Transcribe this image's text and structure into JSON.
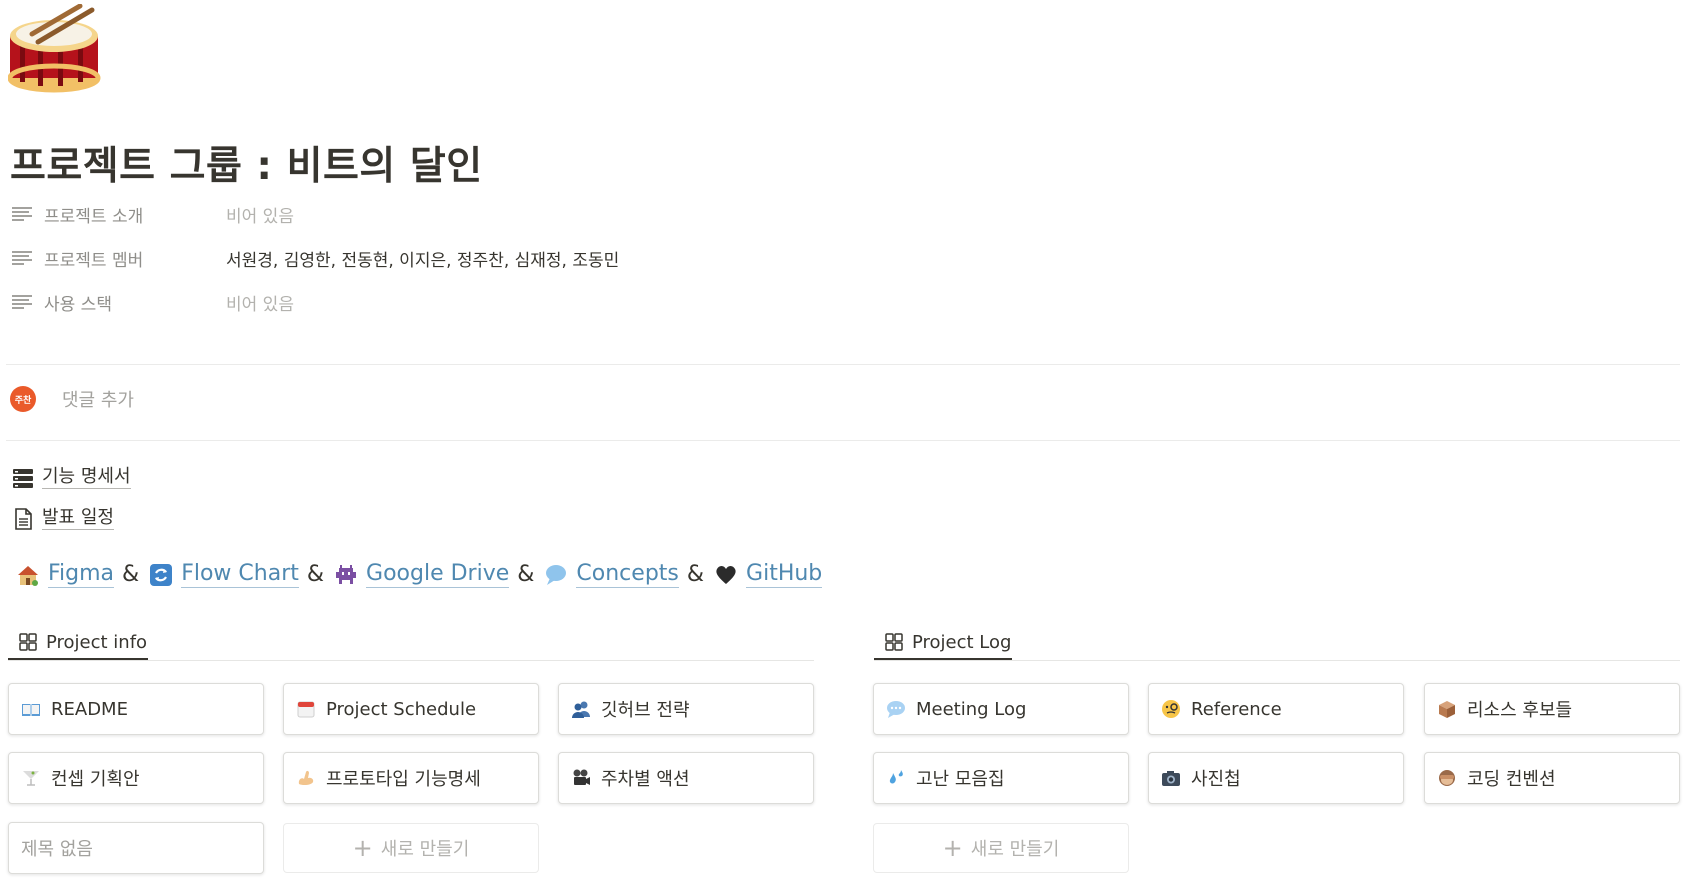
{
  "page": {
    "icon": "drum-icon",
    "title": "프로젝트 그룹 : 비트의 달인"
  },
  "properties": [
    {
      "name": "프로젝트 소개",
      "value": "비어 있음",
      "empty": true
    },
    {
      "name": "프로젝트 멤버",
      "value": "서원경, 김영한, 전동현, 이지은, 정주찬, 심재정, 조동민",
      "empty": false
    },
    {
      "name": "사용 스택",
      "value": "비어 있음",
      "empty": true
    }
  ],
  "comment": {
    "avatar_text": "주찬",
    "placeholder": "댓글 추가"
  },
  "doc_links": [
    {
      "label": "기능 명세서",
      "icon": "database-icon"
    },
    {
      "label": "발표 일정",
      "icon": "document-icon"
    }
  ],
  "links": {
    "separator": "&",
    "items": [
      {
        "label": "Figma",
        "icon": "house-icon"
      },
      {
        "label": "Flow Chart",
        "icon": "repeat-arrows-icon"
      },
      {
        "label": "Google Drive",
        "icon": "alien-monster-icon"
      },
      {
        "label": "Concepts",
        "icon": "speech-balloon-icon"
      },
      {
        "label": "GitHub",
        "icon": "black-heart-icon"
      }
    ]
  },
  "galleries": {
    "info": {
      "tab_label": "Project info",
      "cards": [
        {
          "label": "README",
          "icon": "open-book-icon"
        },
        {
          "label": "Project Schedule",
          "icon": "calendar-icon"
        },
        {
          "label": "깃허브 전략",
          "icon": "people-icon"
        },
        {
          "label": "컨셉 기획안",
          "icon": "cocktail-icon"
        },
        {
          "label": "프로토타입 기능명세",
          "icon": "flexed-arm-icon"
        },
        {
          "label": "주차별 액션",
          "icon": "film-camera-icon"
        }
      ],
      "untitled_label": "제목 없음",
      "new_label": "새로 만들기"
    },
    "log": {
      "tab_label": "Project Log",
      "cards": [
        {
          "label": "Meeting Log",
          "icon": "speech-bubble-icon"
        },
        {
          "label": "Reference",
          "icon": "monocle-face-icon"
        },
        {
          "label": "리소스 후보들",
          "icon": "package-icon"
        },
        {
          "label": "고난 모음집",
          "icon": "sweat-droplets-icon"
        },
        {
          "label": "사진첩",
          "icon": "camera-icon"
        },
        {
          "label": "코딩 컨벤션",
          "icon": "see-no-evil-monkey-icon"
        }
      ],
      "new_label": "새로 만들기"
    }
  }
}
